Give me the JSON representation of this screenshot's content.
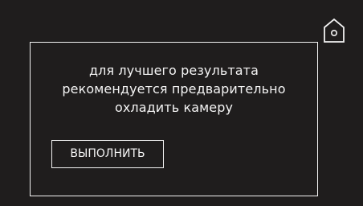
{
  "screen": {
    "home_icon": "home-icon",
    "message_lines": [
      "для лучшего результата",
      "рекомендуется предварительно",
      "охладить камеру"
    ],
    "run_button_label": "ВЫПОЛНИТЬ"
  },
  "colors": {
    "background": "#1f1d1d",
    "foreground": "#f4f4f4"
  }
}
